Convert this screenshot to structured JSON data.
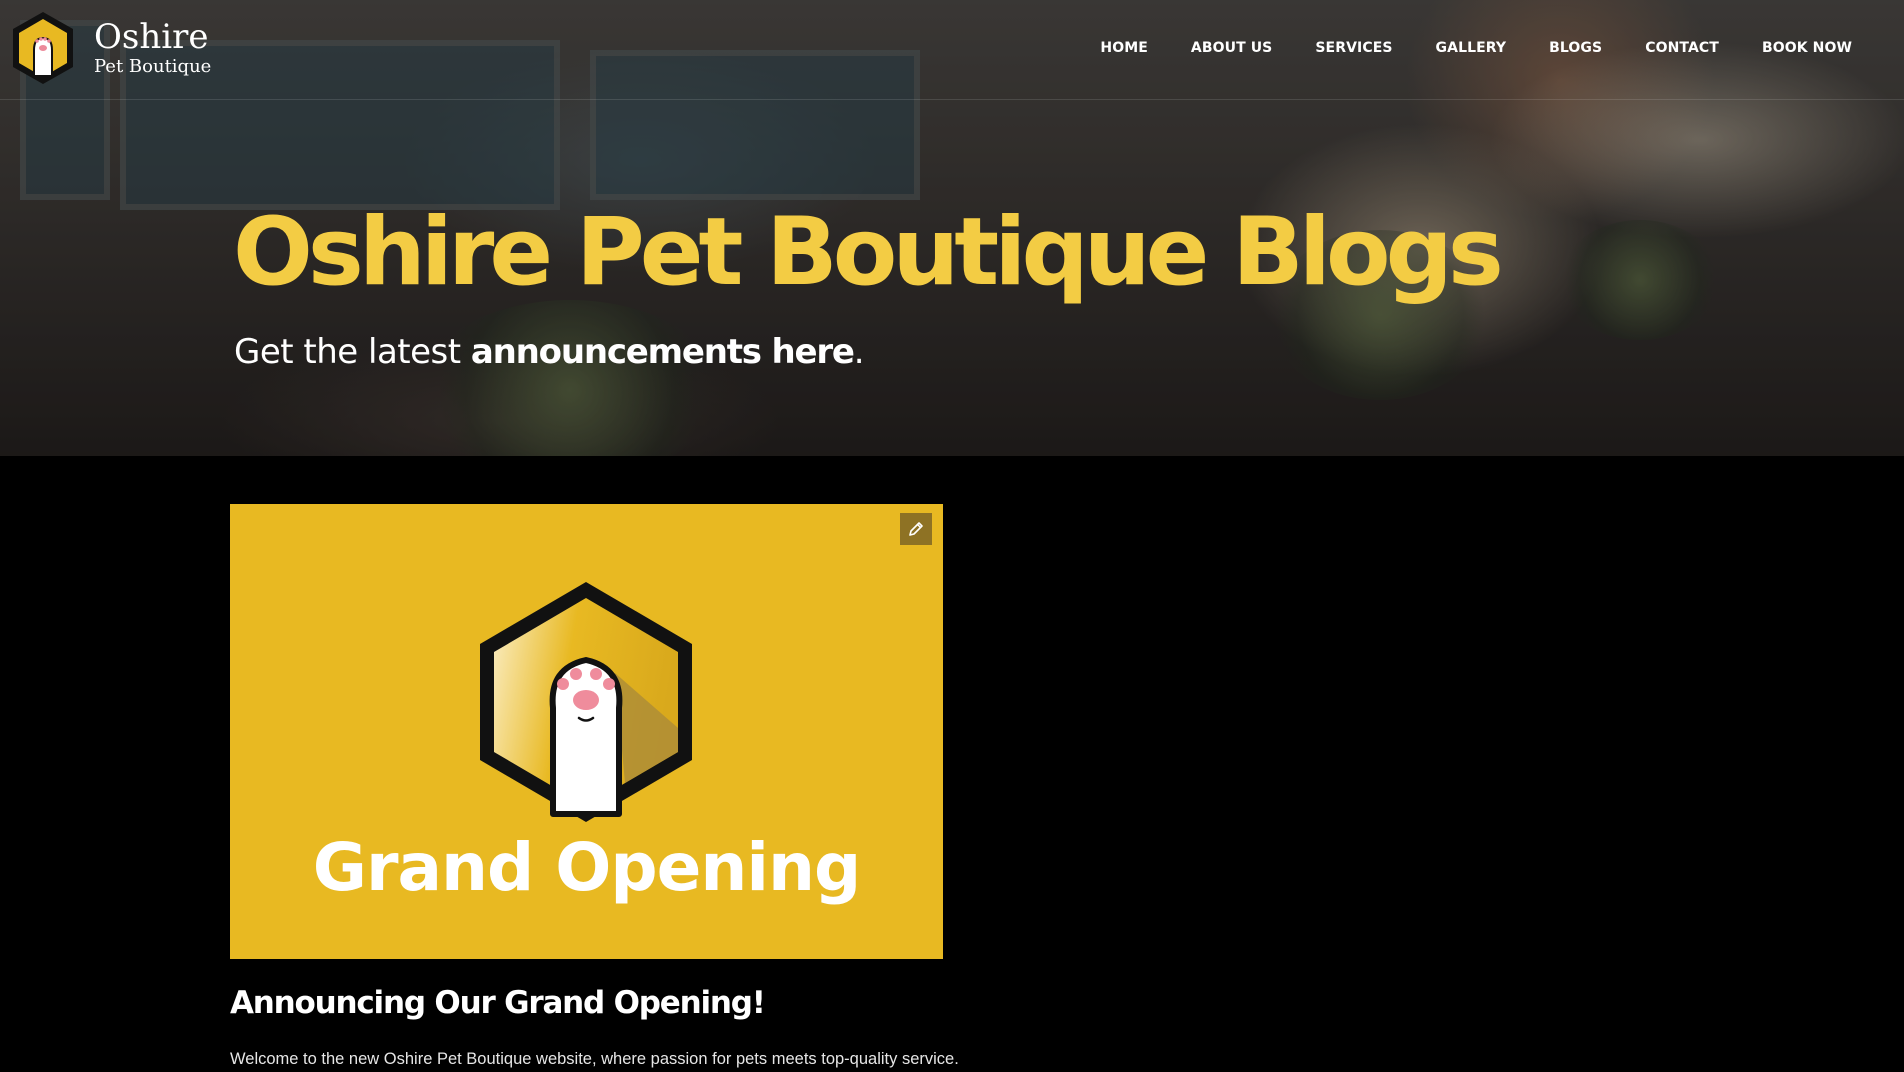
{
  "brand": {
    "name": "Oshire",
    "tagline": "Pet Boutique",
    "accent_color": "#f3cc44",
    "card_color": "#e8b922"
  },
  "nav": {
    "items": [
      {
        "label": "HOME"
      },
      {
        "label": "ABOUT US"
      },
      {
        "label": "SERVICES"
      },
      {
        "label": "GALLERY"
      },
      {
        "label": "BLOGS"
      },
      {
        "label": "CONTACT"
      },
      {
        "label": "BOOK NOW"
      }
    ]
  },
  "hero": {
    "title": "Oshire Pet Boutique Blogs",
    "subtitle_plain": "Get the latest ",
    "subtitle_bold": "announcements here",
    "subtitle_end": "."
  },
  "post": {
    "image_caption": "Grand Opening",
    "edit_icon": "pencil-icon",
    "title": "Announcing Our Grand Opening!",
    "excerpt": "Welcome to the new Oshire Pet Boutique website, where passion for pets meets top-quality service."
  }
}
